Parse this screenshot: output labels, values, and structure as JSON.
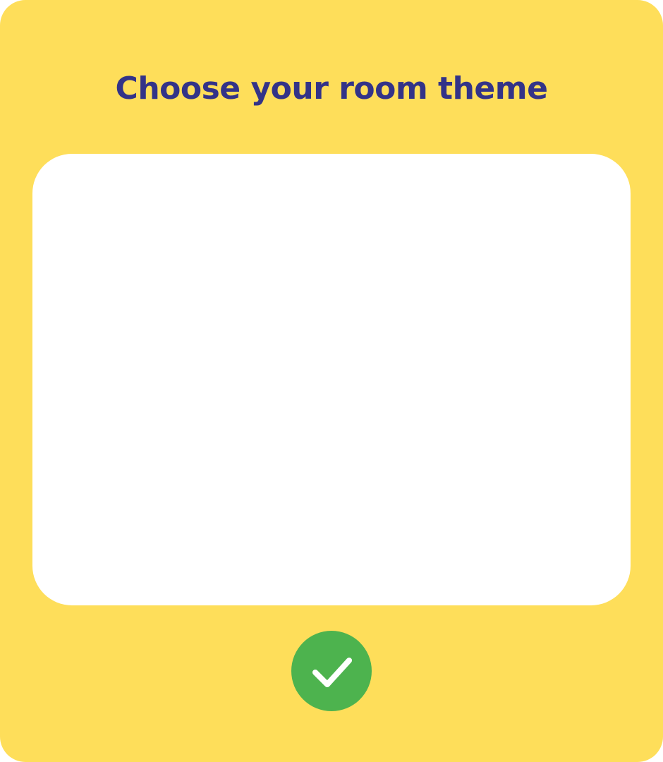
{
  "dialog": {
    "title": "Choose your room theme",
    "confirm_icon": "checkmark-icon"
  },
  "colors": {
    "panel_background": "#FEDE5A",
    "title_text": "#333388",
    "card_background": "#FFFFFF",
    "confirm_button": "#4DB34E",
    "confirm_icon": "#FFFFFF"
  }
}
